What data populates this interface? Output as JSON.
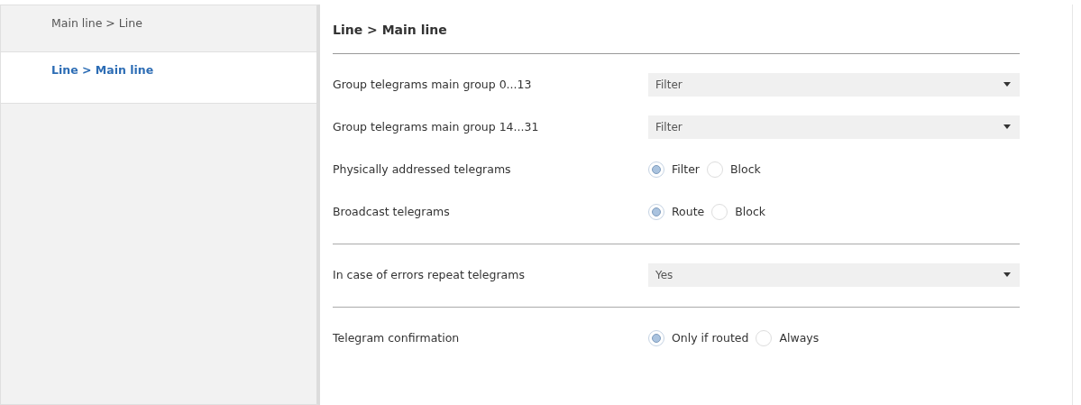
{
  "sidebar": {
    "items": [
      {
        "label": "Main line > Line",
        "selected": false
      },
      {
        "label": "Line > Main line",
        "selected": true
      }
    ]
  },
  "panel": {
    "title": "Line > Main line",
    "sections": [
      {
        "rows": [
          {
            "kind": "dropdown",
            "label": "Group telegrams main group 0...13",
            "value": "Filter"
          },
          {
            "kind": "dropdown",
            "label": "Group telegrams main group 14...31",
            "value": "Filter"
          },
          {
            "kind": "radio",
            "label": "Physically addressed telegrams",
            "options": [
              {
                "label": "Filter",
                "selected": true
              },
              {
                "label": "Block",
                "selected": false
              }
            ]
          },
          {
            "kind": "radio",
            "label": "Broadcast telegrams",
            "options": [
              {
                "label": "Route",
                "selected": true
              },
              {
                "label": "Block",
                "selected": false
              }
            ]
          }
        ]
      },
      {
        "rows": [
          {
            "kind": "dropdown",
            "label": "In case of errors repeat telegrams",
            "value": "Yes"
          }
        ]
      },
      {
        "rows": [
          {
            "kind": "radio",
            "label": "Telegram confirmation",
            "options": [
              {
                "label": "Only if routed",
                "selected": true
              },
              {
                "label": "Always",
                "selected": false
              }
            ]
          }
        ]
      }
    ]
  }
}
